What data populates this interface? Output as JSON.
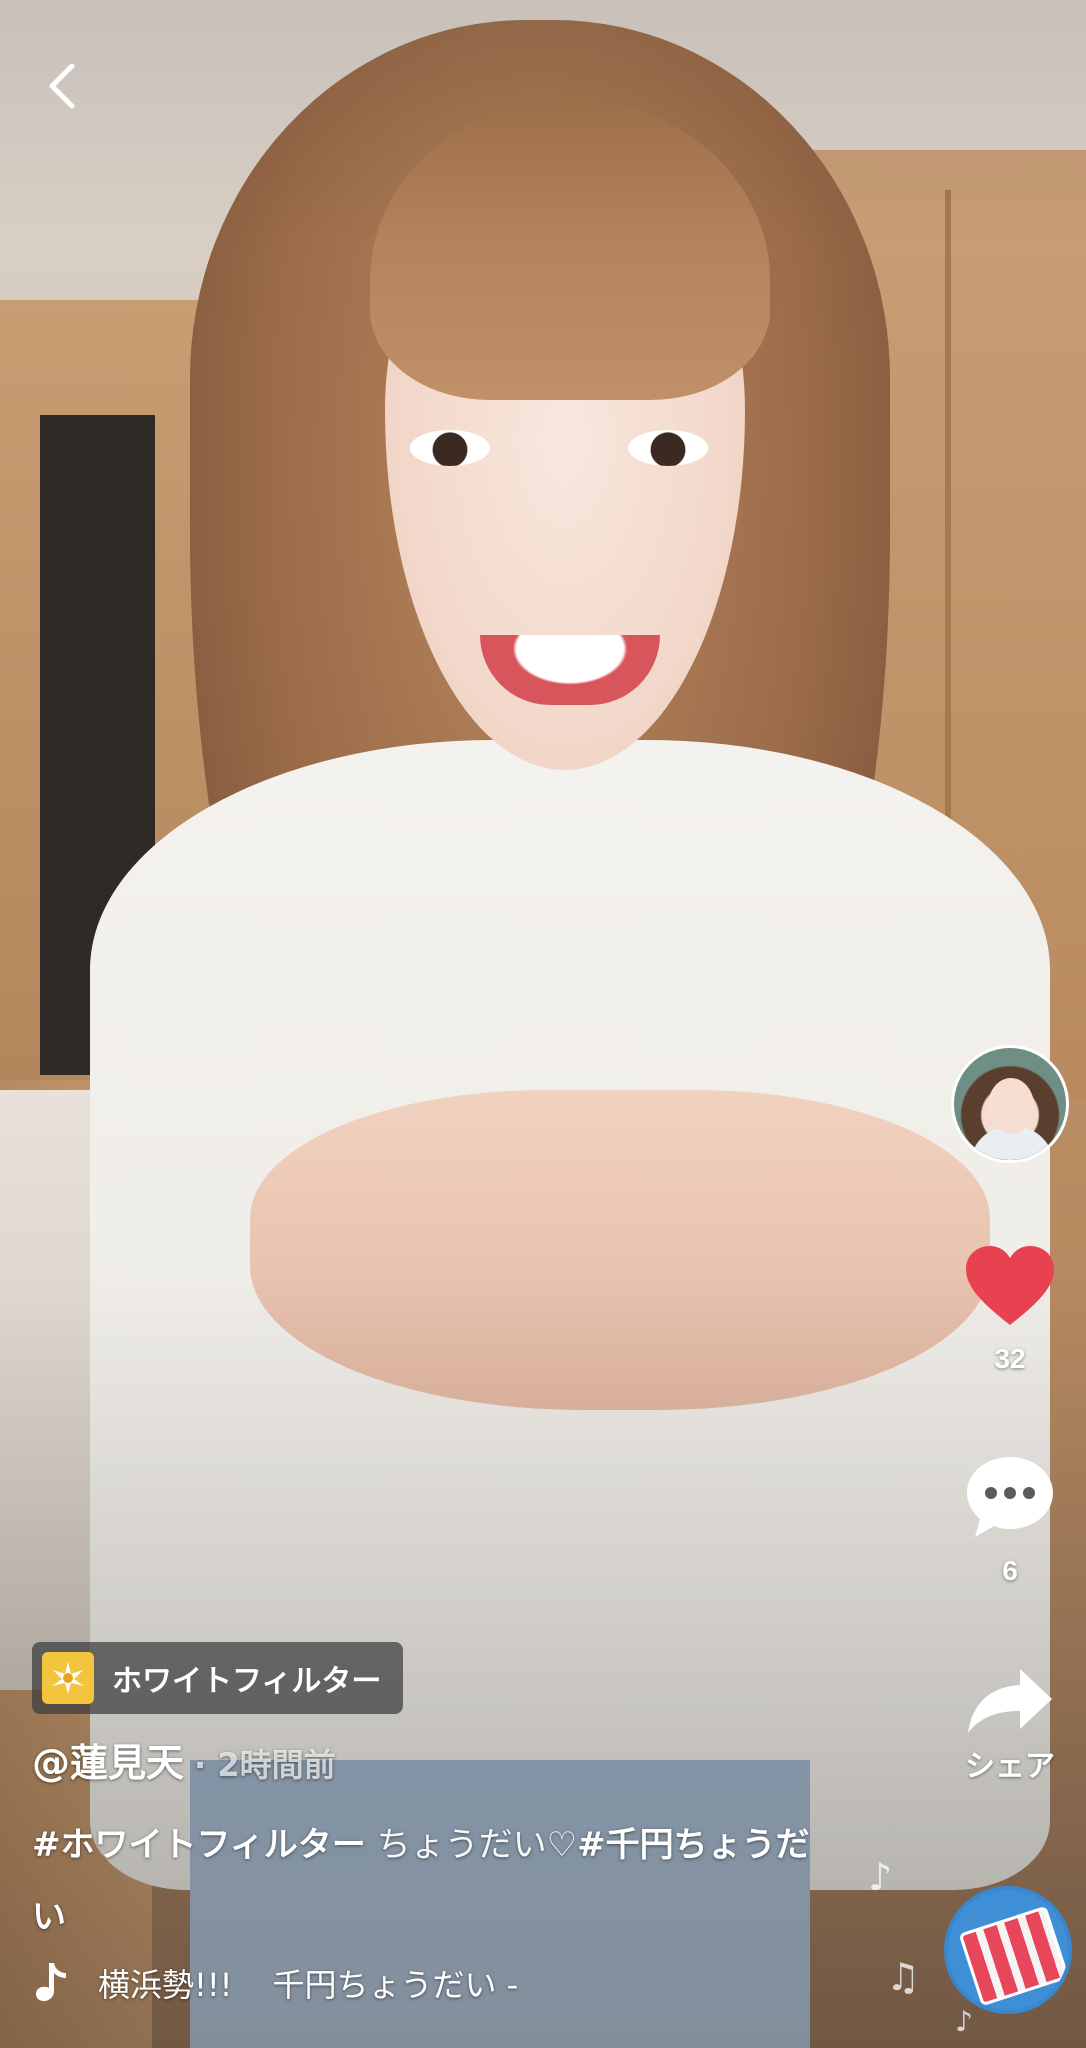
{
  "nav": {
    "back_icon": "chevron-left-icon"
  },
  "side_rail": {
    "like_count": "32",
    "comment_count": "6",
    "share_label": "シェア",
    "colors": {
      "like_heart": "#e8414f",
      "icon_white": "#ffffff"
    }
  },
  "effect": {
    "label": "ホワイトフィルター",
    "icon_color": "#f3c53e"
  },
  "post": {
    "author": "@蓮見天",
    "time": "· 2時間前",
    "hashtag_1": "#ホワイトフィルター",
    "text_1": " ちょうだい♡",
    "hashtag_2": "#千円ちょうだい"
  },
  "sound": {
    "title_a": "横浜勢!!!",
    "title_b": "千円ちょうだい -"
  }
}
